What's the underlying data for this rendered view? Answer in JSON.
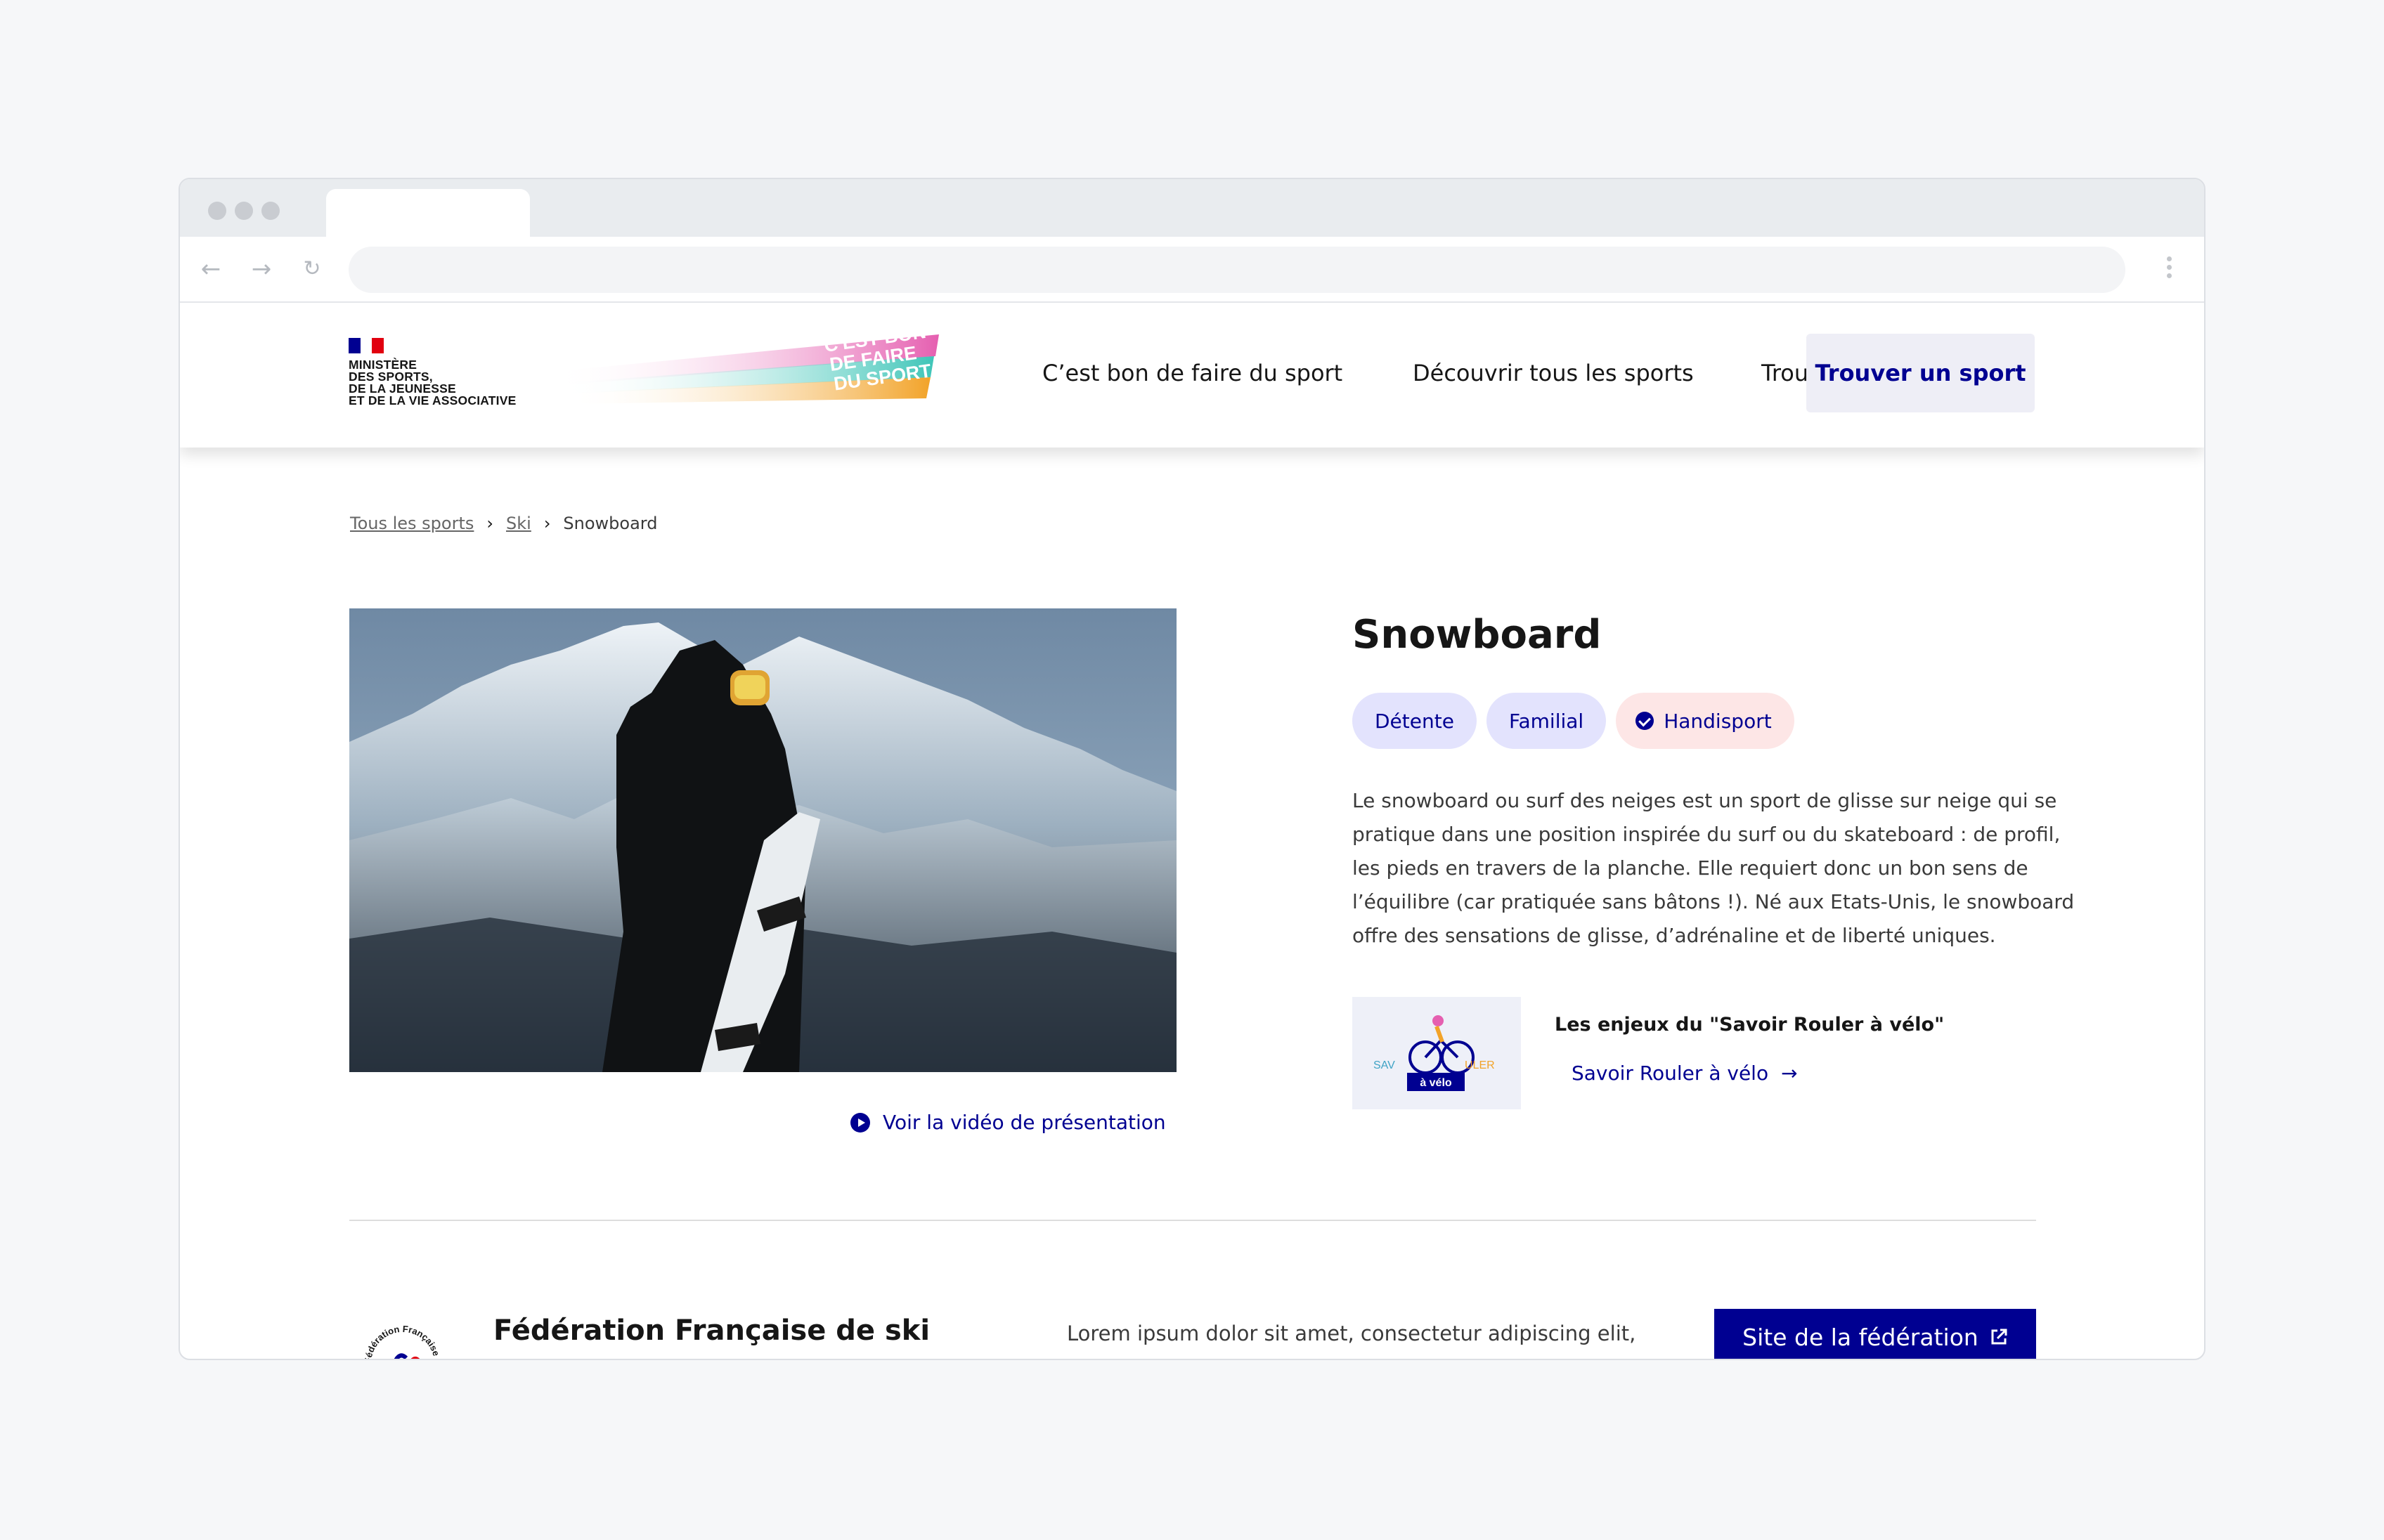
{
  "header": {
    "ministry_lines": [
      "MINISTÈRE",
      "DES SPORTS,",
      "DE LA JEUNESSE",
      "ET DE LA VIE ASSOCIATIVE"
    ],
    "brand_lines": [
      "C'EST BON",
      "DE FAIRE",
      "DU SPORT"
    ],
    "nav": [
      "C’est bon de faire du sport",
      "Découvrir tous les sports",
      "Trouver un club"
    ],
    "cta": "Trouver un sport"
  },
  "breadcrumb": {
    "items": [
      "Tous les sports",
      "Ski"
    ],
    "current": "Snowboard"
  },
  "media": {
    "video_link": "Voir la vidéo de présentation"
  },
  "sport": {
    "title": "Snowboard",
    "tags": [
      "Détente",
      "Familial",
      "Handisport"
    ],
    "description": "Le snowboard ou surf des neiges est un sport de glisse sur neige qui se pratique dans une position inspirée du surf ou du skateboard : de profil, les pieds en travers de la planche. Elle requiert donc un bon sens de l’équilibre (car pratiquée sans bâtons !). Né aux Etats-Unis, le snowboard offre des sensations de glisse, d’adrénaline et de liberté uniques."
  },
  "card": {
    "title": "Les enjeux du \"Savoir Rouler à vélo\"",
    "link": "Savoir Rouler à vélo",
    "image_text": [
      "SAV",
      "ULER",
      "à vélo"
    ]
  },
  "federation": {
    "logo_text": "Fédération Française",
    "name": "Fédération Française de ski",
    "description": "Lorem ipsum dolor sit amet, consectetur adipiscing elit,",
    "button": "Site de la fédération"
  },
  "colors": {
    "primary": "#000091",
    "tag_blue": "#e3e3fd",
    "tag_pink": "#fde6e6"
  }
}
